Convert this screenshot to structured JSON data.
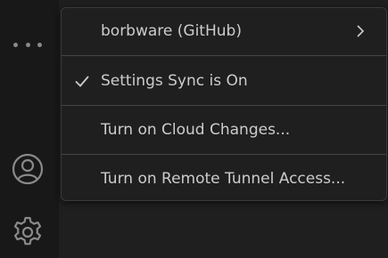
{
  "activity_bar": {
    "more_icon": "ellipsis-icon",
    "account_icon": "account-icon",
    "manage_icon": "gear-icon"
  },
  "menu": {
    "items": [
      {
        "label": "borbware (GitHub)",
        "has_submenu": true,
        "checked": false
      },
      {
        "label": "Settings Sync is On",
        "has_submenu": false,
        "checked": true
      },
      {
        "label": "Turn on Cloud Changes...",
        "has_submenu": false,
        "checked": false
      },
      {
        "label": "Turn on Remote Tunnel Access...",
        "has_submenu": false,
        "checked": false
      }
    ]
  },
  "colors": {
    "background": "#1f1f1f",
    "activity_bar": "#181818",
    "menu_text": "#cccccc",
    "icon": "#8a8a8a",
    "separator": "#454545"
  }
}
